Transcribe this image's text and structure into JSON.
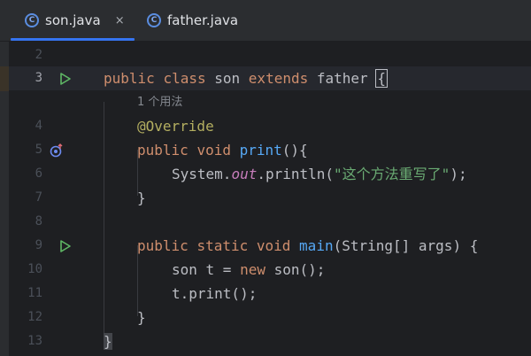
{
  "tabs": [
    {
      "label": "son.java",
      "active": true,
      "icon": "class-icon"
    },
    {
      "label": "father.java",
      "active": false,
      "icon": "class-icon"
    }
  ],
  "tab_close_glyph": "×",
  "tab_icon_glyph": "C",
  "code_lines": [
    {
      "n": "2"
    },
    {
      "n": "3",
      "t": [
        "public",
        "class",
        "son",
        "extends",
        "father",
        "{"
      ]
    },
    {
      "hint": "1 个用法"
    },
    {
      "n": "4",
      "t": [
        "@Override"
      ]
    },
    {
      "n": "5",
      "t": [
        "public",
        "void",
        "print",
        "(){"
      ]
    },
    {
      "n": "6",
      "t": [
        "System.",
        "out",
        ".println(",
        "\"这个方法重写了\"",
        ");"
      ]
    },
    {
      "n": "7",
      "t": [
        "}"
      ]
    },
    {
      "n": "8"
    },
    {
      "n": "9",
      "t": [
        "public",
        "static",
        "void",
        "main",
        "(String[] args) {"
      ]
    },
    {
      "n": "10",
      "t": [
        "son t = ",
        "new",
        " son();"
      ]
    },
    {
      "n": "11",
      "t": [
        "t.print();"
      ]
    },
    {
      "n": "12",
      "t": [
        "}"
      ]
    },
    {
      "n": "13",
      "t": [
        "}"
      ]
    }
  ],
  "colors": {
    "keyword": "#cf8e6d",
    "function": "#56a8f5",
    "annotation": "#b3ae60",
    "string": "#6aab73",
    "static_field": "#c77dbb",
    "run_icon": "#5fb865",
    "override_icon": "#6d8bf0",
    "accent_tab": "#3574f0"
  }
}
